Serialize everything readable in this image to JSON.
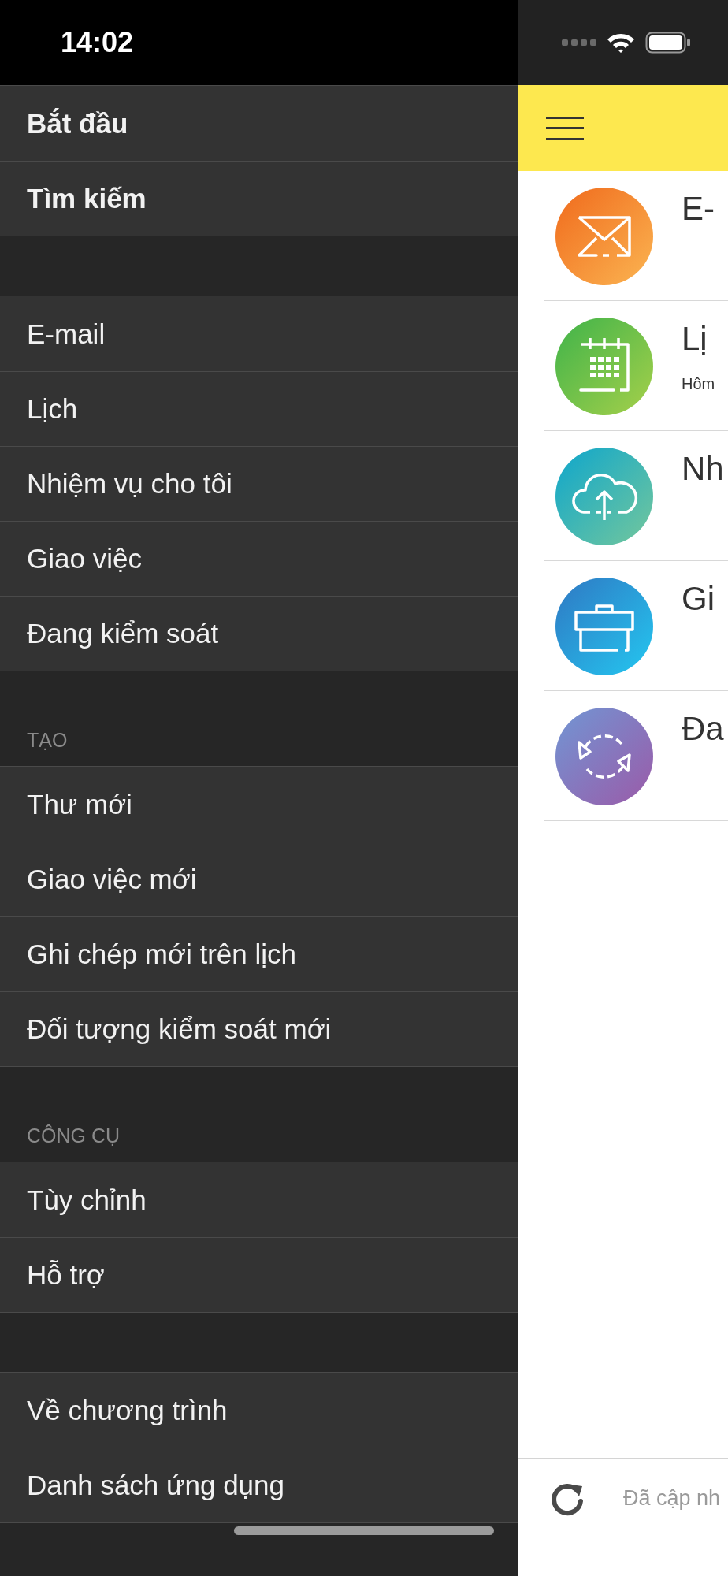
{
  "status_bar": {
    "time": "14:02"
  },
  "menu": {
    "sections": [
      {
        "bold": true,
        "items": [
          {
            "label": "Bắt đầu"
          },
          {
            "label": "Tìm kiếm"
          }
        ]
      },
      {
        "bold": false,
        "items": [
          {
            "label": "E-mail"
          },
          {
            "label": "Lịch"
          },
          {
            "label": "Nhiệm vụ cho tôi"
          },
          {
            "label": "Giao việc"
          },
          {
            "label": "Đang kiểm soát"
          }
        ]
      },
      {
        "header": "TẠO",
        "bold": false,
        "items": [
          {
            "label": "Thư mới"
          },
          {
            "label": "Giao việc mới"
          },
          {
            "label": "Ghi chép mới trên lịch"
          },
          {
            "label": "Đối tượng kiểm soát mới"
          }
        ]
      },
      {
        "header": "CÔNG CỤ",
        "bold": false,
        "items": [
          {
            "label": "Tùy chỉnh"
          },
          {
            "label": "Hỗ trợ"
          }
        ]
      },
      {
        "bold": false,
        "items": [
          {
            "label": "Về chương trình"
          },
          {
            "label": "Danh sách ứng dụng"
          }
        ]
      }
    ]
  },
  "content": {
    "items": [
      {
        "kind": "mail",
        "title": "E-"
      },
      {
        "kind": "calendar",
        "title": "Lị",
        "subtitle": "Hôm"
      },
      {
        "kind": "cloud",
        "title": "Nh"
      },
      {
        "kind": "briefcase",
        "title": "Gi"
      },
      {
        "kind": "sync",
        "title": "Đa"
      }
    ],
    "footer": {
      "status": "Đã cập nh"
    }
  }
}
